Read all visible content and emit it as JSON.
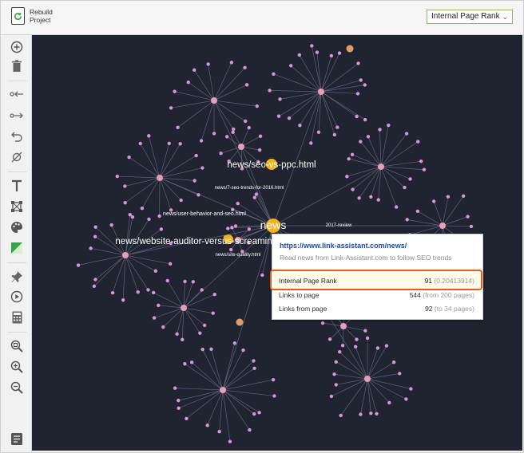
{
  "topbar": {
    "rebuild_line1": "Rebuild",
    "rebuild_line2": "Project",
    "rebuild_icon": "refresh-icon",
    "metric_select": "Internal Page Rank"
  },
  "sidebar": {
    "tools": [
      "add-icon",
      "trash-icon",
      "incoming-links-icon",
      "outgoing-links-icon",
      "undo-icon",
      "hide-node-icon",
      "text-icon",
      "layout-icon",
      "palette-icon",
      "color-icon",
      "pin-icon",
      "play-icon",
      "calculator-icon",
      "zoom-fit-icon",
      "zoom-in-icon",
      "zoom-out-icon",
      "report-icon"
    ]
  },
  "graph": {
    "labels": [
      "news/seo-vs-ppc.html",
      "news/7-seo-trends-for-2016.html",
      "news/user-behavior-and-seo.html",
      "news",
      "2017-review",
      "news/website-auditor-versus-screaming-frog.html",
      "news/site-quality.html"
    ],
    "edge_color": "#6f6a8a",
    "small_node_color": "#d896d6",
    "hub_node_color": "#e3a0b6",
    "highlight_node_color": "#f2b31a",
    "orange_node_color": "#e59a6a"
  },
  "popup": {
    "url": "https://www.link-assistant.com/news/",
    "description": "Read news from Link-Assistant.com to follow SEO trends",
    "rows": [
      {
        "label": "Internal Page Rank",
        "value": "91",
        "meta": "(0.20413914)"
      },
      {
        "label": "Links to page",
        "value": "544",
        "meta": "(from 200 pages)"
      },
      {
        "label": "Links from page",
        "value": "92",
        "meta": "(to 34 pages)"
      }
    ]
  }
}
